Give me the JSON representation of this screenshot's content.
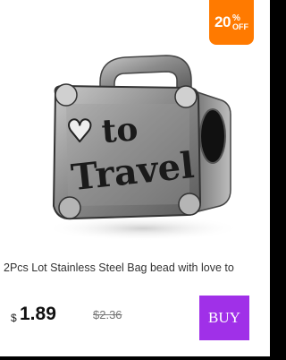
{
  "badge": {
    "number": "20",
    "percent": "%",
    "off": "OFF"
  },
  "bead": {
    "engraving_line1": "to",
    "engraving_line2": "Travel",
    "heart": "♥"
  },
  "product": {
    "title": "2Pcs Lot Stainless Steel Bag bead with love to",
    "currency": "$",
    "price": "1.89",
    "old_price": "$2.36"
  },
  "buy_button": {
    "label": "BUY"
  },
  "colors": {
    "badge": "#ff7a00",
    "buy": "#a030e8"
  }
}
